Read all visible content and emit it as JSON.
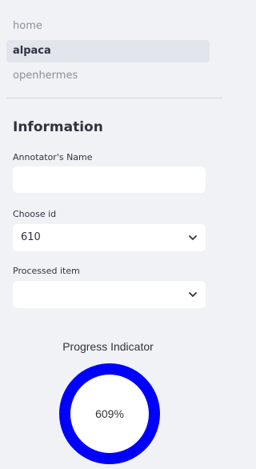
{
  "nav": {
    "items": [
      {
        "label": "home",
        "active": false
      },
      {
        "label": "alpaca",
        "active": true
      },
      {
        "label": "openhermes",
        "active": false
      }
    ]
  },
  "info": {
    "title": "Information",
    "annotator_label": "Annotator's Name",
    "annotator_value": "",
    "choose_id_label": "Choose id",
    "choose_id_value": "610",
    "processed_label": "Processed item",
    "processed_value": ""
  },
  "progress": {
    "title": "Progress Indicator",
    "text": "609%",
    "percent": 609,
    "ring_color": "#0000ff"
  },
  "icons": {
    "dropdown": "chevron-down-icon"
  },
  "colors": {
    "sidebar_bg": "#f0f2f6",
    "active_bg": "#e2e5ec",
    "inactive_text": "#8b8e99",
    "ring": "#0000ff"
  }
}
